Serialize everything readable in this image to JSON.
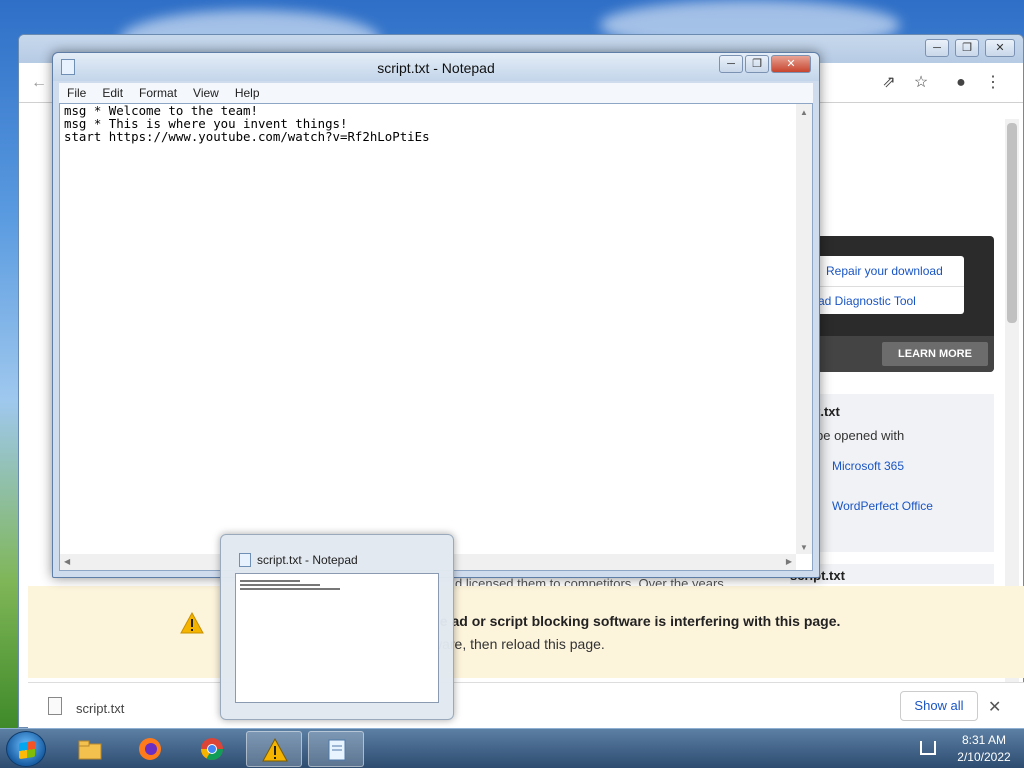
{
  "notepad": {
    "title": "script.txt - Notepad",
    "menu": [
      "File",
      "Edit",
      "Format",
      "View",
      "Help"
    ],
    "content": "msg * Welcome to the team!\nmsg * This is where you invent things!\nstart https://www.youtube.com/watch?v=Rf2hLoPtiEs"
  },
  "preview": {
    "title": "script.txt - Notepad"
  },
  "ad": {
    "link1": "Repair your download",
    "link2": "ad Diagnostic Tool",
    "button": "LEARN MORE"
  },
  "info": {
    "title": "t.txt",
    "subtitle": "be opened with",
    "app1": "Microsoft 365",
    "app2": "WordPerfect Office",
    "title2": "script.txt",
    "bg_text": "d licensed them to competitors. Over the years"
  },
  "warning": {
    "line1": "se ad or script blocking software is interfering with this page.",
    "line2": "ware, then reload this page."
  },
  "downloads": {
    "file": "script.txt",
    "show_all": "Show all"
  },
  "taskbar": {
    "apps": [
      "file-explorer",
      "firefox",
      "chrome",
      "warning-app",
      "notepad"
    ],
    "time": "8:31 AM",
    "date": "2/10/2022"
  },
  "colors": {
    "link": "#1a55c4",
    "warning_bg": "#fdf4dc",
    "ad_bg": "#2b2b2b"
  }
}
